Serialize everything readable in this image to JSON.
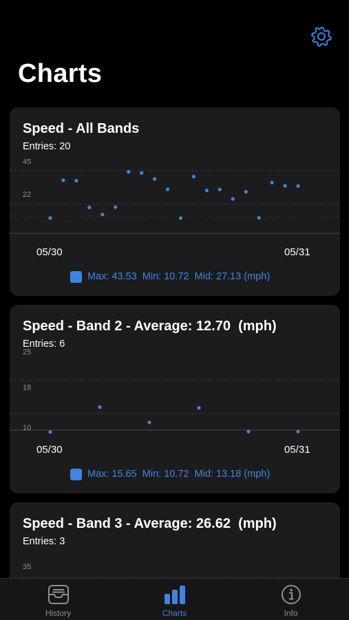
{
  "header": {
    "title": "Charts",
    "settings_icon": "gear-icon"
  },
  "colors": {
    "accent": "#3f85e0",
    "card": "#1c1c1e",
    "background": "#000000",
    "inactive": "#8e8e93"
  },
  "cards": [
    {
      "title": "Speed - All Bands",
      "entries_label": "Entries:",
      "entries_value": "20",
      "legend_text": "Max: 43.53  Min: 10.72  Mid: 27.13 (mph)",
      "x_labels": [
        "05/30",
        "05/31"
      ],
      "chart_data": {
        "type": "scatter",
        "ylim": [
          0,
          55
        ],
        "yticks": [
          22,
          45
        ],
        "y_tick_labels": [
          "22",
          "45"
        ],
        "series": [
          {
            "values": [
              10.7,
              37.5,
              37.2,
              18.3,
              13.3,
              18.5,
              43.5,
              42.6,
              38.4,
              31.1,
              10.7,
              40.1,
              30.3,
              31.0,
              24.3,
              29.4,
              10.9,
              35.8,
              33.6,
              33.4
            ]
          }
        ]
      }
    },
    {
      "title": "Speed - Band 2 - Average: 12.70  (mph)",
      "entries_label": "Entries:",
      "entries_value": "6",
      "legend_text": "Max: 15.65  Min: 10.72  Mid: 13.18 (mph)",
      "x_labels": [
        "05/30",
        "05/31"
      ],
      "chart_data": {
        "type": "scatter",
        "ylim": [
          10,
          25
        ],
        "yticks": [
          10,
          18,
          25
        ],
        "y_tick_labels": [
          "10",
          "18",
          "25"
        ],
        "series": [
          {
            "values": [
              10.72,
              15.65,
              12.6,
              15.5,
              10.8,
              10.8
            ]
          }
        ]
      }
    },
    {
      "title": "Speed - Band 3 - Average: 26.62  (mph)",
      "entries_label": "Entries:",
      "entries_value": "3",
      "chart_data": {
        "type": "scatter",
        "yticks": [
          35
        ],
        "y_tick_labels": [
          "35"
        ],
        "series": [
          {
            "values": []
          }
        ]
      }
    }
  ],
  "tabbar": {
    "tabs": [
      {
        "label": "History",
        "icon": "inbox-tray-icon",
        "active": false
      },
      {
        "label": "Charts",
        "icon": "bar-chart-icon",
        "active": true
      },
      {
        "label": "Info",
        "icon": "info-circle-icon",
        "active": false
      }
    ]
  }
}
